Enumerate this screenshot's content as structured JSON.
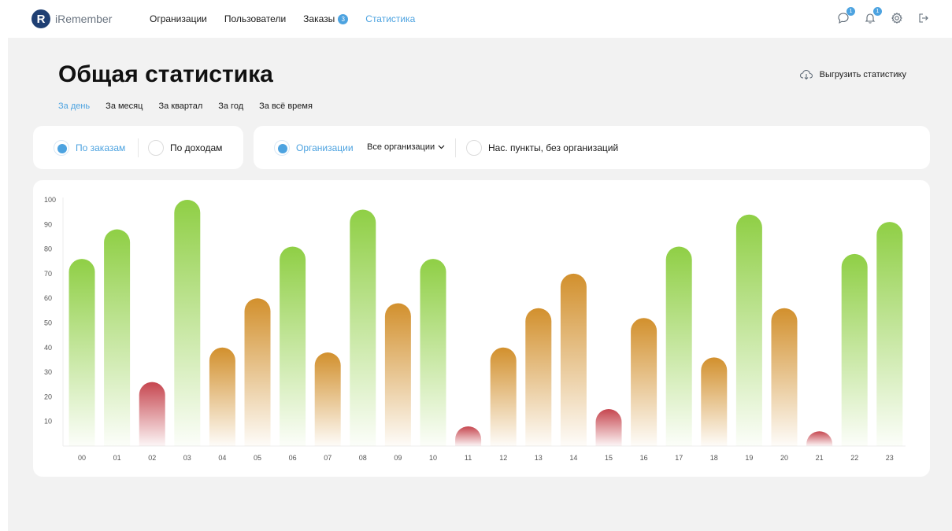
{
  "app": {
    "name": "iRemember",
    "logo_letter": "R"
  },
  "nav": {
    "items": [
      {
        "label": "Огранизации"
      },
      {
        "label": "Пользователи"
      },
      {
        "label": "Заказы",
        "badge": "3"
      },
      {
        "label": "Статистика",
        "active": true
      }
    ]
  },
  "top_icons": {
    "chat_badge": "1",
    "bell_badge": "1",
    "names": [
      "chat-icon",
      "bell-icon",
      "gear-icon",
      "logout-icon"
    ]
  },
  "page": {
    "title": "Общая статистика",
    "export_label": "Выгрузить статистику",
    "period_tabs": [
      {
        "label": "За день",
        "active": true
      },
      {
        "label": "За месяц"
      },
      {
        "label": "За квартал"
      },
      {
        "label": "За год"
      },
      {
        "label": "За всё время"
      }
    ]
  },
  "filters": {
    "by_orders": "По заказам",
    "by_income": "По доходам",
    "organizations": "Организации",
    "all_organizations": "Все организации",
    "settlements": "Нас. пункты, без организаций"
  },
  "colors": {
    "accent": "#4da3e0",
    "bar_green": "#8fcf45",
    "bar_orange": "#d2902d",
    "bar_red": "#c6464f"
  },
  "chart_data": {
    "type": "bar",
    "categories": [
      "00",
      "01",
      "02",
      "03",
      "04",
      "05",
      "06",
      "07",
      "08",
      "09",
      "10",
      "11",
      "12",
      "13",
      "14",
      "15",
      "16",
      "17",
      "18",
      "19",
      "20",
      "21",
      "22",
      "23"
    ],
    "values": [
      76,
      88,
      26,
      100,
      40,
      60,
      81,
      38,
      96,
      58,
      76,
      8,
      40,
      56,
      70,
      15,
      52,
      81,
      36,
      94,
      56,
      6,
      78,
      91
    ],
    "ylim": [
      0,
      100
    ],
    "yticks": [
      10,
      20,
      30,
      40,
      50,
      60,
      70,
      80,
      90,
      100
    ],
    "color_rule": "green >= 75, orange 30–74, red < 30",
    "grid": false,
    "legend": "none"
  }
}
